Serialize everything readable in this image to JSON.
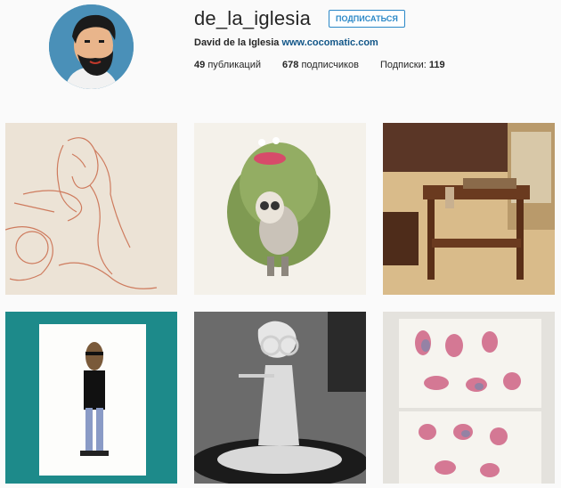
{
  "profile": {
    "username": "de_la_iglesia",
    "follow_label": "ПОДПИСАТЬСЯ",
    "full_name": "David de la Iglesia",
    "website": "www.cocomatic.com"
  },
  "stats": {
    "posts_count": "49",
    "posts_label": "публикаций",
    "followers_count": "678",
    "followers_label": "подписчиков",
    "following_label": "Подписки:",
    "following_count": "119"
  },
  "colors": {
    "accent_blue": "#2b88c7",
    "link_blue": "#125688",
    "background": "#fafafa"
  },
  "posts": [
    {
      "subject": "red-pencil-sketch-mermaid"
    },
    {
      "subject": "green-hairy-monster-skull"
    },
    {
      "subject": "wooden-desk-studio"
    },
    {
      "subject": "cartoon-man-with-glasses-print"
    },
    {
      "subject": "edna-mode-sculpture"
    },
    {
      "subject": "pink-mice-sketches"
    }
  ]
}
